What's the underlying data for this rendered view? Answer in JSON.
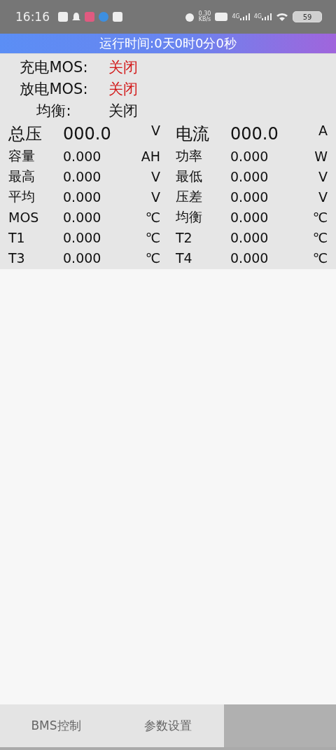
{
  "status_bar": {
    "time": "16:16",
    "net_speed": "0.30",
    "net_unit": "KB/s",
    "signals": [
      "4G",
      "4G"
    ],
    "battery": "59"
  },
  "header": {
    "title": "运行时间:0天0时0分0秒"
  },
  "switches": [
    {
      "label": "充电MOS:",
      "value": "关闭",
      "alarm": true
    },
    {
      "label": "放电MOS:",
      "value": "关闭",
      "alarm": true
    },
    {
      "label": "均衡:",
      "value": "关闭",
      "alarm": false
    }
  ],
  "main": [
    {
      "label": "总压",
      "value": "000.0",
      "unit": "V"
    },
    {
      "label": "电流",
      "value": "000.0",
      "unit": "A"
    }
  ],
  "readings": [
    {
      "label": "容量",
      "value": "0.000",
      "unit": "AH"
    },
    {
      "label": "功率",
      "value": "0.000",
      "unit": "W"
    },
    {
      "label": "最高",
      "value": "0.000",
      "unit": "V"
    },
    {
      "label": "最低",
      "value": "0.000",
      "unit": "V"
    },
    {
      "label": "平均",
      "value": "0.000",
      "unit": "V"
    },
    {
      "label": "压差",
      "value": "0.000",
      "unit": "V"
    },
    {
      "label": "MOS",
      "value": "0.000",
      "unit": "℃"
    },
    {
      "label": "均衡",
      "value": "0.000",
      "unit": "℃"
    },
    {
      "label": "T1",
      "value": "0.000",
      "unit": "℃"
    },
    {
      "label": "T2",
      "value": "0.000",
      "unit": "℃"
    },
    {
      "label": "T3",
      "value": "0.000",
      "unit": "℃"
    },
    {
      "label": "T4",
      "value": "0.000",
      "unit": "℃"
    }
  ],
  "tabs": [
    {
      "label": "BMS控制",
      "selected": false
    },
    {
      "label": "参数设置",
      "selected": false
    },
    {
      "selected": true
    }
  ]
}
